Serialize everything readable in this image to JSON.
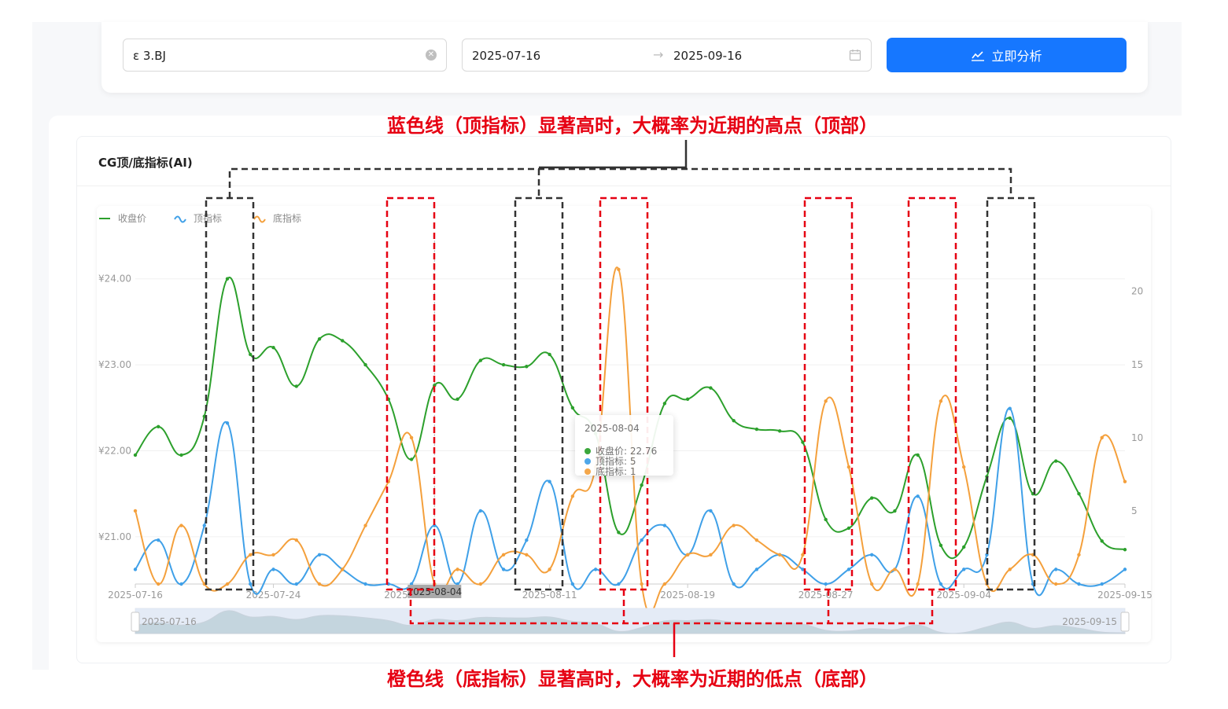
{
  "toolbar": {
    "stock_code": "ε     3.BJ",
    "date_start": "2025-07-16",
    "date_sep": "→",
    "date_end": "2025-09-16",
    "analyze_label": "立即分析"
  },
  "card": {
    "title": "CG顶/底指标(AI)"
  },
  "annotations": {
    "top": "蓝色线（顶指标）显著高时，大概率为近期的高点（顶部）",
    "bottom": "橙色线（底指标）显著高时，大概率为近期的低点（底部）"
  },
  "tooltip": {
    "date": "2025-08-04",
    "rows": [
      "收盘价: 22.76",
      "顶指标: 5",
      "底指标: 1"
    ]
  },
  "colors": {
    "close": "#2ca02c",
    "top": "#3fa0e8",
    "bottom": "#f4a03c",
    "accent": "#1677ff",
    "annotation": "#e60012"
  },
  "chart_data": {
    "type": "line",
    "title": "CG顶/底指标(AI)",
    "x": [
      "2025-07-16",
      "2025-07-17",
      "2025-07-18",
      "2025-07-21",
      "2025-07-22",
      "2025-07-23",
      "2025-07-24",
      "2025-07-25",
      "2025-07-28",
      "2025-07-29",
      "2025-07-30",
      "2025-07-31",
      "2025-08-01",
      "2025-08-04",
      "2025-08-05",
      "2025-08-06",
      "2025-08-07",
      "2025-08-08",
      "2025-08-11",
      "2025-08-12",
      "2025-08-13",
      "2025-08-14",
      "2025-08-15",
      "2025-08-18",
      "2025-08-19",
      "2025-08-20",
      "2025-08-21",
      "2025-08-22",
      "2025-08-25",
      "2025-08-26",
      "2025-08-27",
      "2025-08-28",
      "2025-08-29",
      "2025-09-01",
      "2025-09-02",
      "2025-09-03",
      "2025-09-04",
      "2025-09-05",
      "2025-09-08",
      "2025-09-09",
      "2025-09-10",
      "2025-09-11",
      "2025-09-12",
      "2025-09-15"
    ],
    "xticks": [
      "2025-07-16",
      "2025-07-24",
      "2025-08-01",
      "2025-08-11",
      "2025-08-19",
      "2025-08-27",
      "2025-09-04",
      "2025-09-15"
    ],
    "ylim_left": [
      20.45,
      24.5
    ],
    "yticks_left": [
      "¥21.00",
      "¥22.00",
      "¥23.00",
      "¥24.00"
    ],
    "ylim_right": [
      0,
      23.8
    ],
    "yticks_right": [
      "5",
      "10",
      "15",
      "20"
    ],
    "legend_position": "top-left",
    "series": [
      {
        "name": "收盘价",
        "axis": "left",
        "values": [
          21.95,
          22.28,
          21.95,
          22.4,
          24.0,
          23.12,
          23.2,
          22.75,
          23.3,
          23.28,
          23.0,
          22.6,
          21.9,
          22.76,
          22.6,
          23.05,
          23.0,
          22.98,
          23.12,
          22.5,
          22.2,
          21.05,
          21.6,
          22.55,
          22.6,
          22.73,
          22.35,
          22.25,
          22.23,
          22.1,
          21.2,
          21.1,
          21.45,
          21.3,
          21.95,
          20.9,
          20.88,
          21.7,
          22.38,
          21.5,
          21.88,
          21.5,
          20.95,
          20.85
        ]
      },
      {
        "name": "顶指标",
        "axis": "right",
        "values": [
          1,
          3,
          0,
          4,
          11,
          0,
          1,
          0,
          2,
          1,
          0,
          0,
          0,
          4,
          0,
          5,
          1,
          3,
          7,
          0,
          1,
          0,
          3,
          4,
          2,
          5,
          0,
          1,
          2,
          1,
          0,
          1,
          2,
          1,
          6,
          0,
          1,
          2,
          12,
          0,
          1,
          0,
          0,
          1
        ]
      },
      {
        "name": "底指标",
        "axis": "right",
        "values": [
          5,
          0,
          4,
          0,
          0,
          2,
          2,
          3,
          0,
          1,
          4,
          7,
          10,
          0,
          1,
          0,
          2,
          2,
          1,
          6,
          8,
          21.5,
          0,
          0,
          2,
          2,
          4,
          3,
          2,
          2,
          12.5,
          8,
          0,
          1,
          0,
          12.5,
          8,
          0,
          1,
          2,
          0,
          2,
          10,
          7
        ]
      }
    ],
    "datazoom": {
      "start_label": "2025-07-16",
      "end_label": "2025-09-15"
    },
    "axis_pointer_label": "2025-08-04"
  }
}
